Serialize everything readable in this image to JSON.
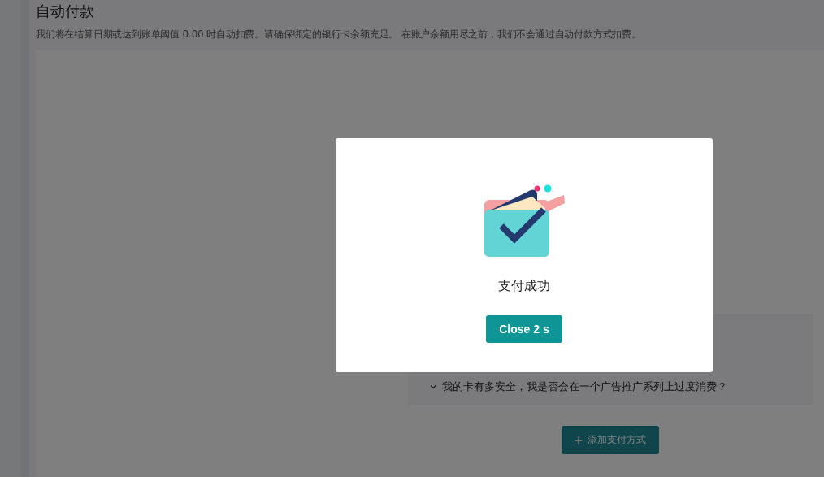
{
  "page": {
    "title": "自动付款",
    "description": "我们将在结算日期或达到账单阈值 0.00 时自动扣费。请确保绑定的银行卡余额充足。 在账户余额用尽之前，我们不会通过自动付款方式扣费。"
  },
  "faq": [
    {
      "question": "我的卡有多安全，我是否会在一个广告推广系列上过度消费？",
      "expanded": false
    }
  ],
  "add_button": {
    "label": "添加支付方式"
  },
  "dialog": {
    "message": "支付成功",
    "button": "Close 2 s"
  }
}
